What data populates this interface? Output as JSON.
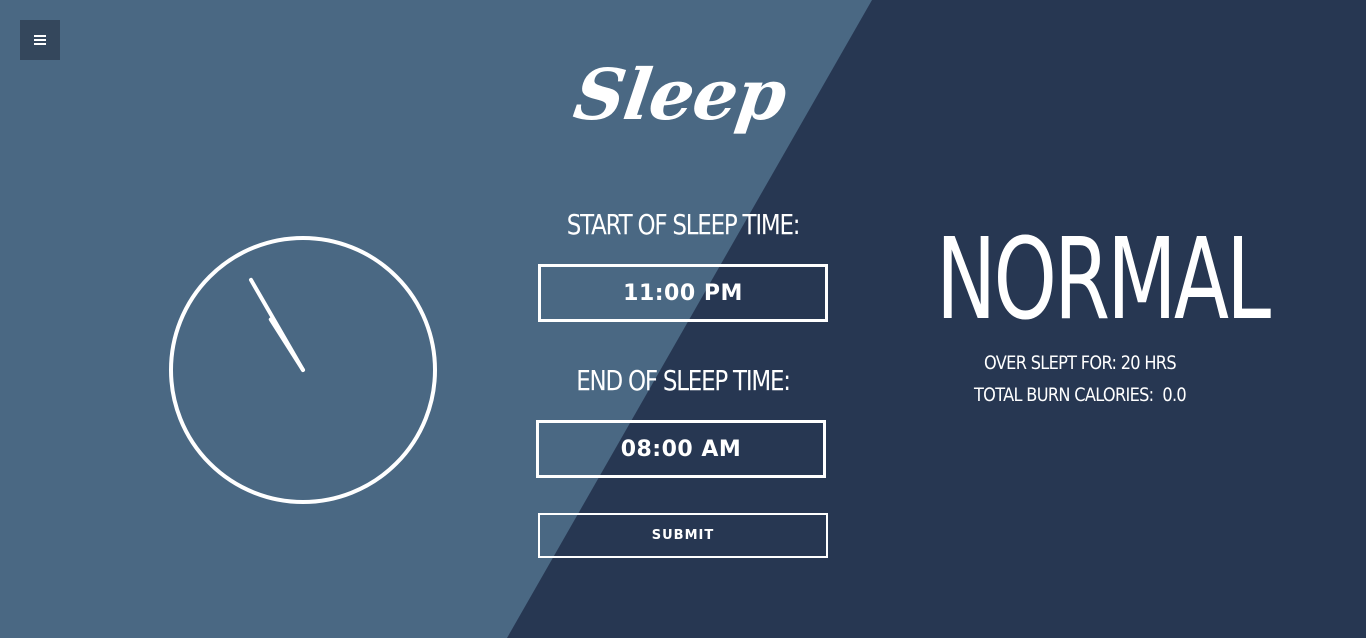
{
  "colors": {
    "background_light": "#4a6883",
    "background_dark": "#273752",
    "menu_button": "#34475c",
    "foreground": "#ffffff"
  },
  "menu": {
    "icon": "hamburger-menu-icon"
  },
  "app": {
    "title": "Sleep"
  },
  "form": {
    "start_label": "START OF SLEEP TIME:",
    "start_value": "11:00 PM",
    "end_label": "END OF SLEEP TIME:",
    "end_value": "08:00 AM",
    "submit_label": "SUBMIT"
  },
  "clock": {
    "icon": "analog-clock",
    "hour": 10,
    "minute": 55
  },
  "result": {
    "status": "NORMAL",
    "overslept_text": "OVER SLEPT FOR: 20 HRS",
    "calories_text": "TOTAL BURN CALORIES:  0.0"
  }
}
